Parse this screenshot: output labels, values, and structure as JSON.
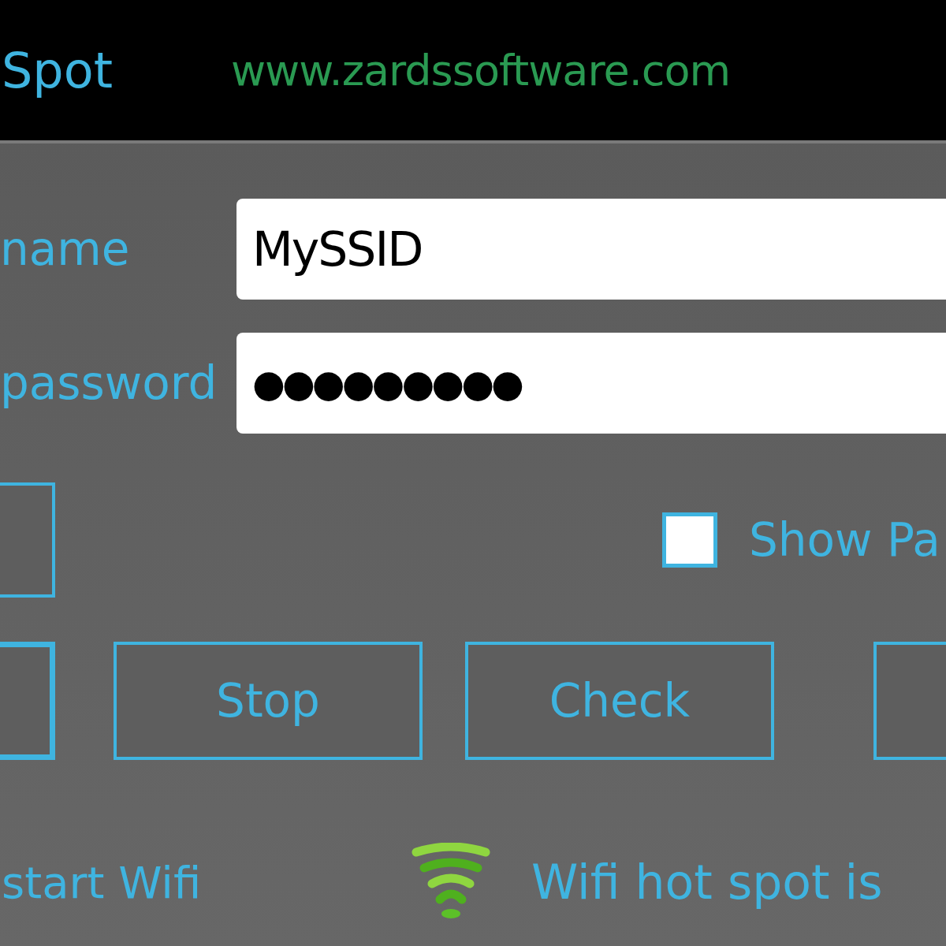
{
  "header": {
    "title": "Spot",
    "website": "www.zardssoftware.com"
  },
  "fields": [
    {
      "label": "name",
      "value": "MySSID"
    },
    {
      "label": "password",
      "value": "●●●●●●●●●"
    }
  ],
  "show_password": {
    "label": "Show Pa",
    "checked": false
  },
  "buttons": [
    {
      "label": "Stop"
    },
    {
      "label": "Check"
    }
  ],
  "status": {
    "action": "start Wifi",
    "message": "Wifi hot spot is"
  }
}
